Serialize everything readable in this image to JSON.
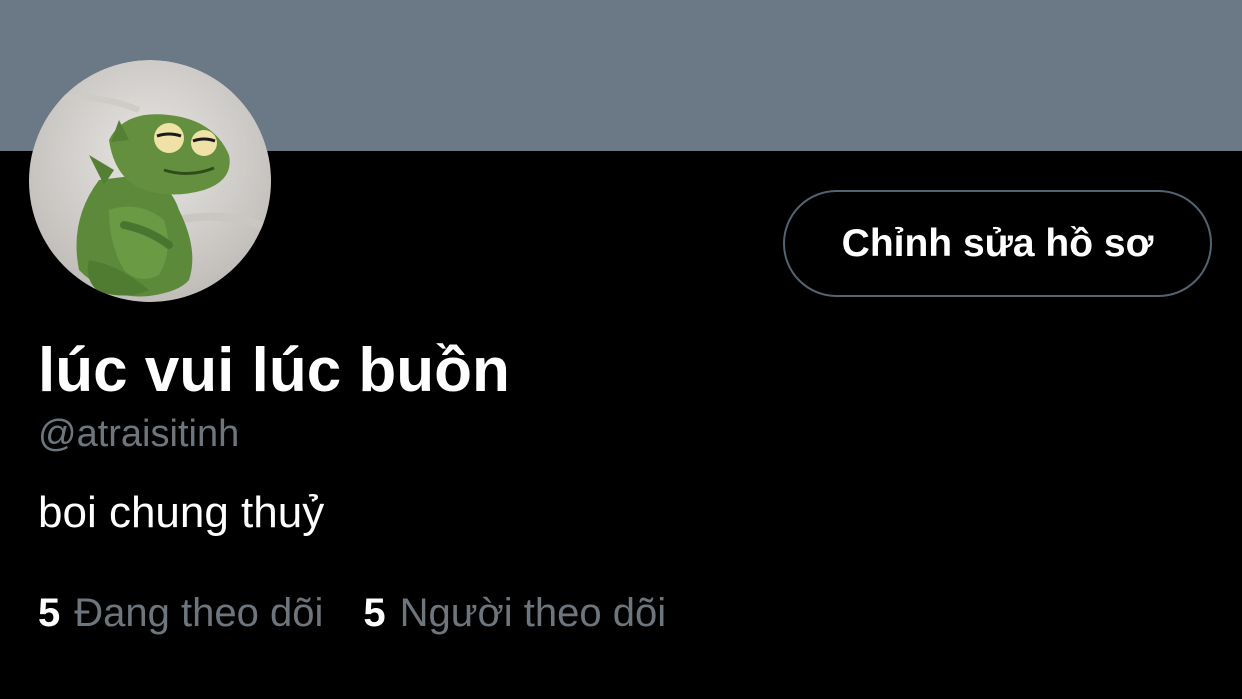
{
  "profile": {
    "banner_color": "#6b7886",
    "avatar_description": "green frog plush avatar",
    "edit_button_label": "Chỉnh sửa hồ sơ",
    "display_name": "lúc vui lúc buồn",
    "handle": "@atraisitinh",
    "bio": "boi chung thuỷ",
    "following": {
      "count": "5",
      "label": "Đang theo dõi"
    },
    "followers": {
      "count": "5",
      "label": "Người theo dõi"
    }
  },
  "colors": {
    "background": "#000000",
    "text_primary": "#ffffff",
    "text_secondary": "#6e767d",
    "button_border": "#536471"
  }
}
